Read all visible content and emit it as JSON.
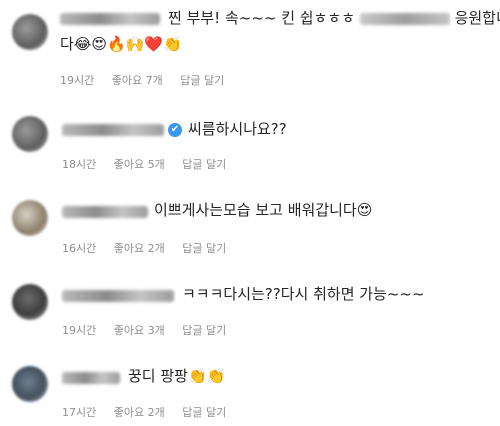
{
  "comments": [
    {
      "text_line1_a": "찐 부부! 속~~~ 킨 쉽ㅎㅎㅎ",
      "text_line1_b": "응원합니",
      "text_line2": "다",
      "emojis": "😂😍🔥🙌❤️👏",
      "time": "19시간",
      "likes": "좋아요 7개",
      "reply": "답글 달기"
    },
    {
      "verified_icon": "✔",
      "text": "씨름하시나요??",
      "time": "18시간",
      "likes": "좋아요 5개",
      "reply": "답글 달기"
    },
    {
      "text": "이쁘게사는모습 보고 배워갑니다",
      "emojis": "😍",
      "time": "16시간",
      "likes": "좋아요 2개",
      "reply": "답글 달기"
    },
    {
      "text": "ㅋㅋㅋ다시는??다시 취하면 가능~~~",
      "time": "19시간",
      "likes": "좋아요 3개",
      "reply": "답글 달기"
    },
    {
      "text": "꿍디 팡팡",
      "emojis": "👏👏",
      "time": "17시간",
      "likes": "좋아요 2개",
      "reply": "답글 달기"
    }
  ]
}
